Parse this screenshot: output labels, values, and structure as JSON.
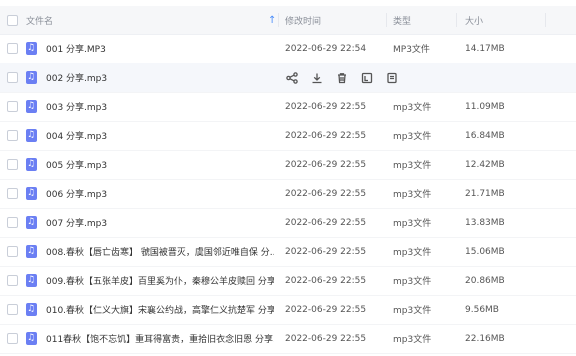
{
  "header": {
    "name": "文件名",
    "time": "修改时间",
    "type": "类型",
    "size": "大小"
  },
  "row_actions": [
    "share-icon",
    "download-icon",
    "delete-icon",
    "rename-icon",
    "more-icon"
  ],
  "files": [
    {
      "name": "001 分享.MP3",
      "time": "2022-06-29 22:54",
      "type": "MP3文件",
      "size": "14.17MB"
    },
    {
      "name": "002 分享.mp3",
      "time": "",
      "type": "",
      "size": ""
    },
    {
      "name": "003 分享.mp3",
      "time": "2022-06-29 22:55",
      "type": "mp3文件",
      "size": "11.09MB"
    },
    {
      "name": "004 分享.mp3",
      "time": "2022-06-29 22:55",
      "type": "mp3文件",
      "size": "16.84MB"
    },
    {
      "name": "005 分享.mp3",
      "time": "2022-06-29 22:55",
      "type": "mp3文件",
      "size": "12.42MB"
    },
    {
      "name": "006 分享.mp3",
      "time": "2022-06-29 22:55",
      "type": "mp3文件",
      "size": "21.71MB"
    },
    {
      "name": "007 分享.mp3",
      "time": "2022-06-29 22:55",
      "type": "mp3文件",
      "size": "13.83MB"
    },
    {
      "name": "008.春秋【唇亡齿寒】 虢国被晋灭，虞国邻近唯自保 分...",
      "time": "2022-06-29 22:55",
      "type": "mp3文件",
      "size": "15.06MB"
    },
    {
      "name": "009.春秋【五张羊皮】百里奚为仆，秦穆公羊皮赎回 分享...",
      "time": "2022-06-29 22:55",
      "type": "mp3文件",
      "size": "20.86MB"
    },
    {
      "name": "010.春秋【仁义大旗】宋襄公约战，高擎仁义抗楚军 分享...",
      "time": "2022-06-29 22:55",
      "type": "mp3文件",
      "size": "9.56MB"
    },
    {
      "name": "011春秋【饱不忘饥】重耳得富贵，重拾旧衣念旧恩 分享...",
      "time": "2022-06-29 22:55",
      "type": "mp3文件",
      "size": "22.16MB"
    }
  ]
}
